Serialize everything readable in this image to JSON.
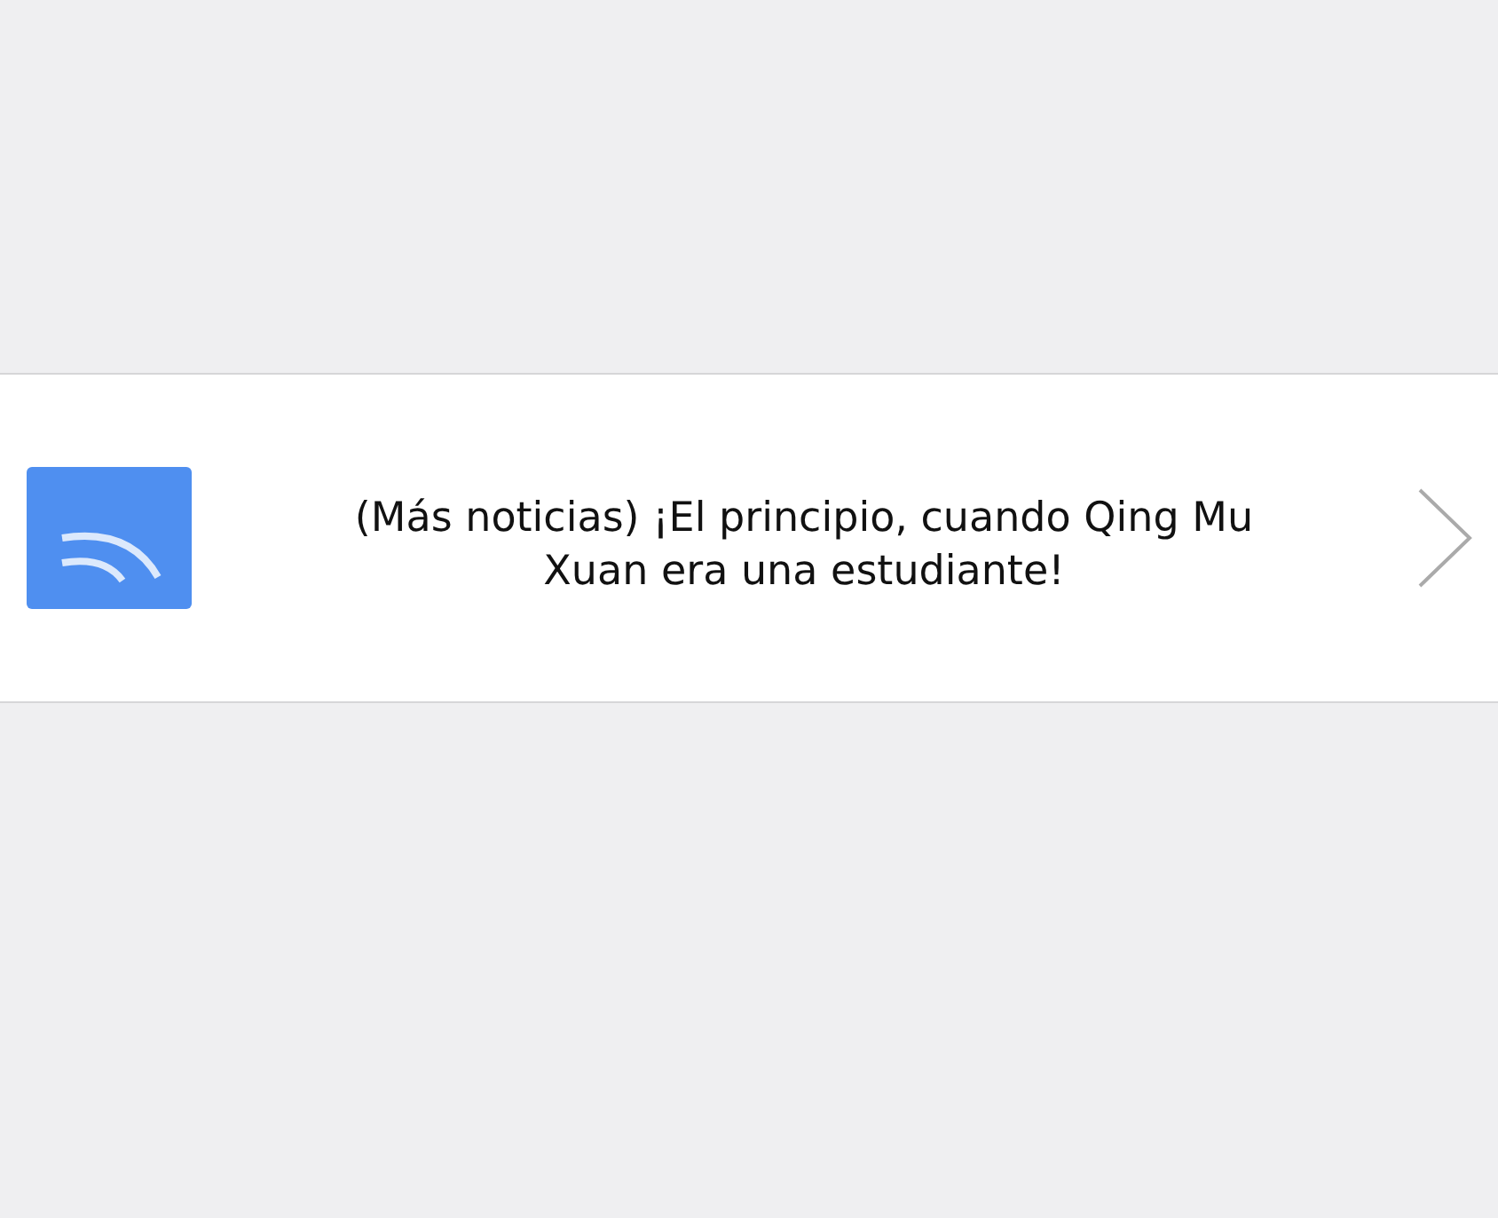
{
  "notification": {
    "text": "(Más noticias) ¡El principio, cuando Qing Mu Xuan era una estudiante!"
  }
}
